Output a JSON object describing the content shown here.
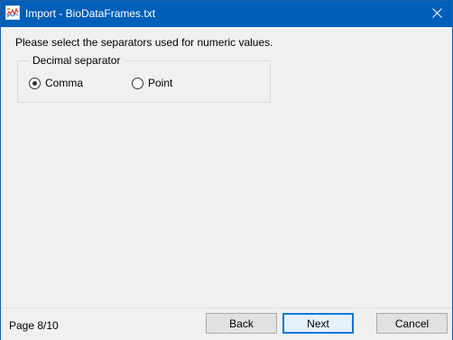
{
  "window": {
    "title": "Import - BioDataFrames.txt",
    "app_icon": "chart-app-icon",
    "close_icon": "close-icon"
  },
  "instruction": "Please select the separators used for numeric values.",
  "decimal_group": {
    "legend": "Decimal separator",
    "options": [
      {
        "label": "Comma",
        "selected": true
      },
      {
        "label": "Point",
        "selected": false
      }
    ]
  },
  "footer": {
    "page_label": "Page  8/10",
    "back_label": "Back",
    "next_label": "Next",
    "cancel_label": "Cancel"
  },
  "colors": {
    "titlebar": "#005fb8",
    "default_button_border": "#0078d7"
  }
}
